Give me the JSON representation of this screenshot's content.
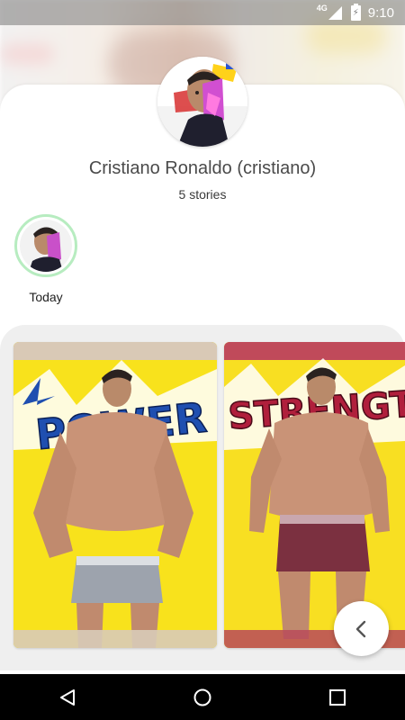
{
  "status_bar": {
    "network": "4G",
    "time": "9:10"
  },
  "profile": {
    "name": "Cristiano Ronaldo (cristiano)",
    "story_count": "5 stories"
  },
  "highlights": [
    {
      "label": "Today"
    }
  ],
  "stories": [
    {
      "title": "POWER",
      "accent": "#1f4fb0"
    },
    {
      "title": "STRENGTH",
      "accent": "#b01f3c"
    }
  ],
  "fab": {
    "icon": "chevron-left-icon"
  },
  "nav": {
    "back_icon": "back-triangle-icon",
    "home_icon": "home-circle-icon",
    "recents_icon": "recents-square-icon"
  },
  "colors": {
    "highlight_ring": "#b7ecc0",
    "panel_bg": "#efefef",
    "story_yellow": "#f7e11a"
  }
}
